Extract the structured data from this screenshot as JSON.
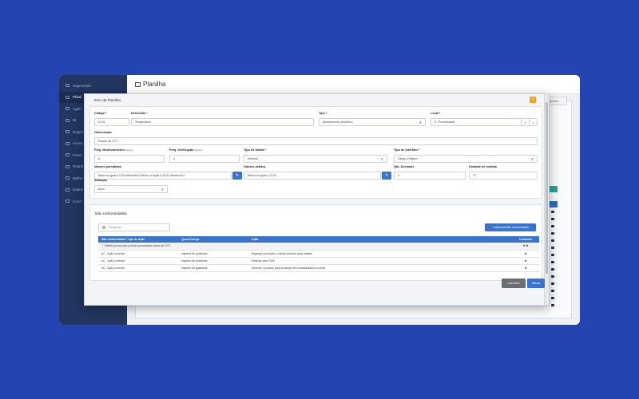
{
  "background": {
    "color": "#2344b1"
  },
  "sidebar": {
    "items": [
      {
        "label": "Supervisão"
      },
      {
        "label": "Planil",
        "active": true
      },
      {
        "label": "Agên"
      },
      {
        "label": "BI"
      },
      {
        "label": "Regist"
      },
      {
        "label": "Acess"
      },
      {
        "label": "Fresh"
      },
      {
        "label": "Relató"
      },
      {
        "label": "Melho"
      },
      {
        "label": "Dados"
      },
      {
        "label": "Confi"
      }
    ]
  },
  "page": {
    "title": "Planilha",
    "background_button": "Impressa"
  },
  "modal": {
    "title": "Item da Planilha",
    "close_icon": "×",
    "form": {
      "codigo": {
        "label": "Código *",
        "value": "01.02"
      },
      "descricao": {
        "label": "Descrição *",
        "value": "Temperatura"
      },
      "tipo": {
        "label": "Tipo *",
        "value": "Apontamento (Analítico)"
      },
      "local": {
        "label": "Local *",
        "value": "5 - Processados"
      },
      "observacao": {
        "label": "Observação",
        "value": "Padrão de 12°C"
      },
      "freq_monitoramento": {
        "label": "Freq. Monitoramento",
        "hint": "(Hora:s)",
        "value": "6"
      },
      "freq_verificacao": {
        "label": "Freq. Verificação",
        "hint": "(Hora:s)",
        "value": "6"
      },
      "tipo_dados": {
        "label": "Tipo de Dados *",
        "value": "Decimal"
      },
      "tipo_interface": {
        "label": "Tipo de Interface *",
        "value": "Campo Editável"
      },
      "valores_permitidos": {
        "label": "Valores permitidos",
        "value": "Maior ou igual a 0,00 referência 0,Menor ou igual a 20,00 referência 0"
      },
      "valores_validos": {
        "label": "Valores válidos",
        "value": "Menor ou igual a 12,00"
      },
      "qtd_decimais": {
        "label": "Qtd. Decimais",
        "value": "2"
      },
      "unidade_medida": {
        "label": "Unidade de medida",
        "value": "°C"
      },
      "situacao": {
        "label": "Situação",
        "value": "Ativo"
      }
    },
    "nao_conformidades": {
      "title": "Não conformidades",
      "search_placeholder": "Pesquisar",
      "add_button": "+ Adicionar Não Conformidade",
      "columns": [
        "Não Conformidade / Tipo de Ação",
        "Quem Corrige",
        "Ação",
        "Comando"
      ],
      "group": {
        "label": "Matéria prima para produto processado acima de 12°C",
        "commands": "✚ ✖"
      },
      "rows": [
        {
          "tipo": "AC - Ação corretiva",
          "quem": "Inspetor de qualidade",
          "acao": "Segregar produção e coletar amostra para análise",
          "cmd": "✖"
        },
        {
          "tipo": "AC - Ação corretiva",
          "quem": "Inspetor de qualidade",
          "acao": "Destinar para CMS",
          "cmd": "✖"
        },
        {
          "tipo": "AC - Ação corretiva",
          "quem": "Inspetor de qualidade",
          "acao": "Destinar o produto para produção de industrializados cozidos",
          "cmd": "✖"
        }
      ]
    },
    "footer": {
      "cancel": "Cancelar",
      "save": "Salvar"
    }
  },
  "colors": {
    "primary": "#3b73c9",
    "sidebar": "#233560",
    "close": "#f0a22d",
    "cancel": "#6b6f75"
  }
}
